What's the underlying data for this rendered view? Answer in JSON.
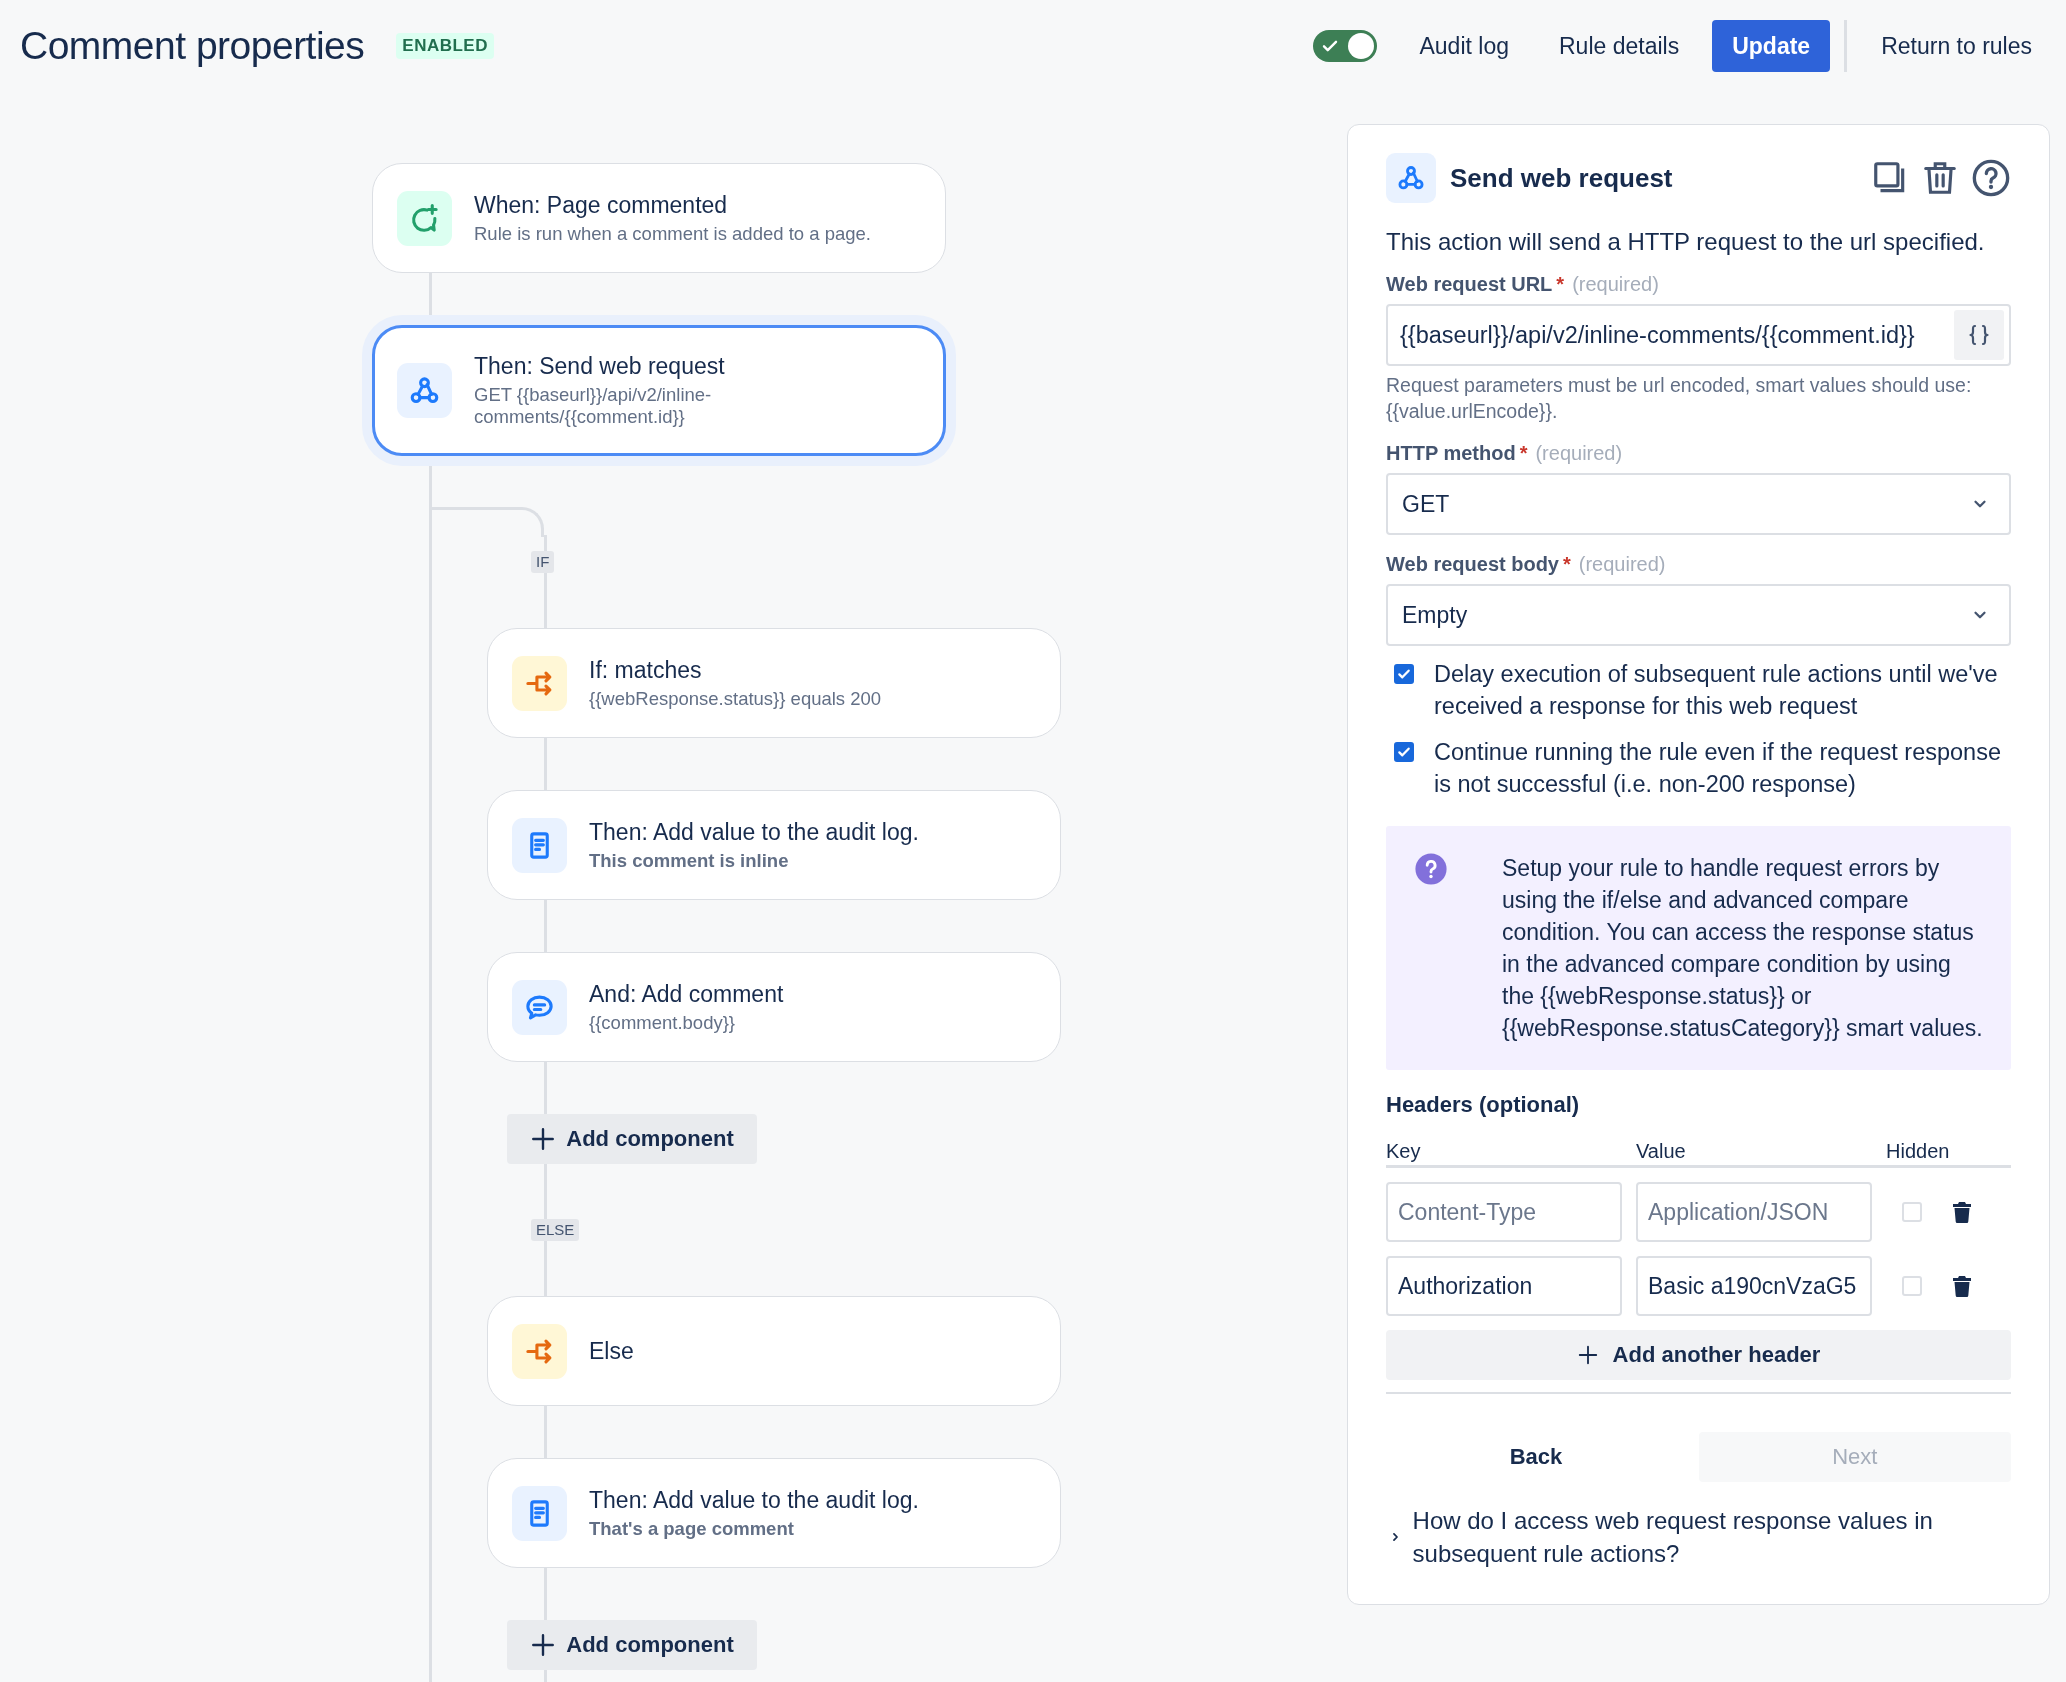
{
  "header": {
    "title": "Comment properties",
    "status": "ENABLED",
    "rule_enabled": true,
    "links": [
      "Audit log",
      "Rule details"
    ],
    "primary_button": "Update",
    "return_link": "Return to rules"
  },
  "flow": {
    "steps": [
      {
        "kind": "trigger",
        "title": "When: Page commented",
        "subtitle": "Rule is run when a comment is added to a page.",
        "subtitle_bold": false,
        "selected": false
      },
      {
        "kind": "webhook",
        "title": "Then: Send web request",
        "subtitle": "GET {{baseurl}}/api/v2/inline-comments/{{comment.id}}",
        "subtitle_bold": false,
        "selected": true
      }
    ],
    "branches": [
      {
        "label": "IF",
        "steps": [
          {
            "kind": "condition",
            "title": "If: matches",
            "subtitle": "{{webResponse.status}} equals 200",
            "subtitle_bold": false,
            "selected": false
          },
          {
            "kind": "log",
            "title": "Then: Add value to the audit log.",
            "subtitle": "This comment is inline",
            "subtitle_bold": true,
            "selected": false
          },
          {
            "kind": "comment",
            "title": "And: Add comment",
            "subtitle": "{{comment.body}}",
            "subtitle_bold": false,
            "selected": false
          }
        ],
        "add_button": "Add component"
      },
      {
        "label": "ELSE",
        "steps": [
          {
            "kind": "condition",
            "title": "Else",
            "selected": false
          },
          {
            "kind": "log",
            "title": "Then: Add value to the audit log.",
            "subtitle": "That's a page comment",
            "subtitle_bold": true,
            "selected": false
          }
        ],
        "add_button": "Add component"
      }
    ]
  },
  "panel": {
    "title": "Send web request",
    "description": "This action will send a HTTP request to the url specified.",
    "fields": [
      {
        "kind": "text",
        "label": "Web request URL",
        "required_mark": "*",
        "hint": "(required)",
        "value": "{{baseurl}}/api/v2/inline-comments/{{comment.id}}",
        "help": "Request parameters must be url encoded, smart values should use: {{value.urlEncode}}."
      },
      {
        "kind": "select",
        "label": "HTTP method",
        "required_mark": "*",
        "hint": "(required)",
        "value": "GET"
      },
      {
        "kind": "select",
        "label": "Web request body",
        "required_mark": "*",
        "hint": "(required)",
        "value": "Empty"
      }
    ],
    "options": [
      {
        "label": "Delay execution of subsequent rule actions until we've received a response for this web request",
        "checked": true
      },
      {
        "label": "Continue running the rule even if the request response is not successful (i.e. non-200 response)",
        "checked": true
      }
    ],
    "info": "Setup your rule to handle request errors by using the if/else and advanced compare condition. You can access the response status in the advanced compare condition by using the {{webResponse.status}} or {{webResponse.statusCategory}} smart values.",
    "headers": {
      "title": "Headers (optional)",
      "columns": [
        "Key",
        "Value",
        "Hidden"
      ],
      "rows": [
        {
          "key": {
            "placeholder": "Content-Type"
          },
          "value": {
            "placeholder": "Application/JSON"
          },
          "hidden": false
        },
        {
          "key": {
            "value": "Authorization"
          },
          "value": {
            "value": "Basic a190cnVzaG5"
          },
          "hidden": false
        }
      ],
      "add_button": "Add another header"
    },
    "footer": {
      "back": "Back",
      "next": "Next",
      "next_disabled": true
    },
    "faq": {
      "text": "How do I access web request response values in subsequent rule actions?",
      "expanded": false
    }
  }
}
